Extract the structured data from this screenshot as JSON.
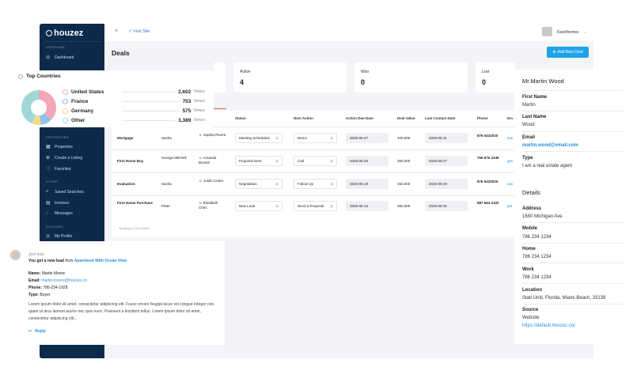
{
  "sidebar": {
    "logo": "houzez",
    "sections": [
      "OVERVIEW",
      "PROPERTIES",
      "OTHER",
      "ACCOUNT"
    ],
    "items": [
      {
        "label": "Dashboard",
        "icon": "dashboard-icon",
        "glyph": "◎"
      },
      {
        "label": "Properties",
        "icon": "grid-icon",
        "glyph": "▦"
      },
      {
        "label": "Create a Listing",
        "icon": "plus-circle-icon",
        "glyph": "⊕"
      },
      {
        "label": "Favorites",
        "icon": "heart-icon",
        "glyph": "♡"
      },
      {
        "label": "Saved Searches",
        "icon": "search-icon",
        "glyph": "⌕"
      },
      {
        "label": "Invoices",
        "icon": "invoice-icon",
        "glyph": "▤"
      },
      {
        "label": "Messages",
        "icon": "message-icon",
        "glyph": "◌"
      },
      {
        "label": "My Profile",
        "icon": "user-icon",
        "glyph": "◎"
      }
    ]
  },
  "topbar": {
    "visit_site": "Visit Site",
    "user": "Favethemes"
  },
  "page": {
    "title": "Deals",
    "new_deal": "Add New Deal"
  },
  "stats": [
    {
      "label": "Active",
      "value": "4"
    },
    {
      "label": "Won",
      "value": "0"
    },
    {
      "label": "Lost",
      "value": "0"
    }
  ],
  "tab_label": "ls (0)",
  "table": {
    "headers": [
      "Status",
      "Next Action",
      "Action Due Date",
      "Deal Value",
      "Last Contact Date",
      "Phone",
      "Em"
    ],
    "rows": [
      {
        "title": "Mortgage",
        "contact": "Sasha",
        "agent": "Sophia Rivera",
        "status": "Meeting Scheduled",
        "next": "Demo",
        "due": "2026-05-27",
        "value": "400,000",
        "last": "2026-05-11",
        "phone": "876 5432020",
        "email": "sas"
      },
      {
        "title": "First Home Buy",
        "contact": "George Mitchell",
        "agent": "Amanda Brooks",
        "status": "Proposal Sent",
        "next": "Call",
        "due": "2026-05-20",
        "value": "250,000",
        "last": "2026-05-27",
        "phone": "756 876 2348",
        "email": "geo"
      },
      {
        "title": "Evaluation",
        "contact": "Sasha",
        "agent": "Justin Carter",
        "status": "Negotiation",
        "next": "Follow Up",
        "due": "2026-05-19",
        "value": "150,000",
        "last": "2026-05-20",
        "phone": "876 5432020",
        "email": "sas"
      },
      {
        "title": "First Home Purchase",
        "contact": "Peter",
        "agent": "Elizabeth Chen",
        "status": "New Lead",
        "next": "Send a Proposal",
        "due": "2026-05-13",
        "value": "250,000",
        "last": "2026-05-01",
        "phone": "987 654 3120",
        "email": "pet"
      }
    ],
    "showing": "Showing 1-4 of 4 items"
  },
  "top_countries": {
    "title": "Top Countries",
    "items": [
      {
        "name": "United States",
        "value": "2,602",
        "unit": "Views",
        "color": "#f3a7b8"
      },
      {
        "name": "France",
        "value": "753",
        "unit": "Views",
        "color": "#8fc3ea"
      },
      {
        "name": "Germany",
        "value": "575",
        "unit": "Views",
        "color": "#f5d88a"
      },
      {
        "name": "Other",
        "value": "3,389",
        "unit": "Views",
        "color": "#9ed8d8"
      }
    ]
  },
  "notification": {
    "time": "Just now",
    "headline": "You got a new lead",
    "from_word": "from",
    "listing": "Apartment With Ocean View",
    "name_label": "Name:",
    "name": "Martin Moore",
    "email_label": "Email:",
    "email": "martin.moore@houzez.co",
    "phone_label": "Phone:",
    "phone": "786-234-1928",
    "type_label": "Type:",
    "type": "Buyer",
    "body": "Lorem ipsum dolor sit amet, consectetur adipiscing elit. Fusce ornare feugiat lacus vel congue Integer non quam ut arcu laoreet auctor nec quis nunc. Praesent a tincidunt tellus. Lorem ipsum dolor sit amet, consectetur adipiscing elit...",
    "reply": "Reply"
  },
  "contact": {
    "name": "Mr.Martin Wood",
    "first_name_label": "First Name",
    "first_name": "Martin",
    "last_name_label": "Last Name",
    "last_name": "Wood",
    "email_label": "Email",
    "email": "martin.wood@email.com",
    "type_label": "Type",
    "type": "I am a real estate agent",
    "details_title": "Details",
    "address_label": "Address",
    "address": "1680 Michigan Ave",
    "mobile_label": "Mobile",
    "mobile": "786 234 1234",
    "home_label": "Home",
    "home": "786 234 1234",
    "work_label": "Work",
    "work": "786 234 1234",
    "location_label": "Location",
    "location": "Stati Uniti, Florida, Miami Beach, 33139",
    "source_label": "Source",
    "source": "Website",
    "source_url": "https://default.houzez.co/"
  }
}
